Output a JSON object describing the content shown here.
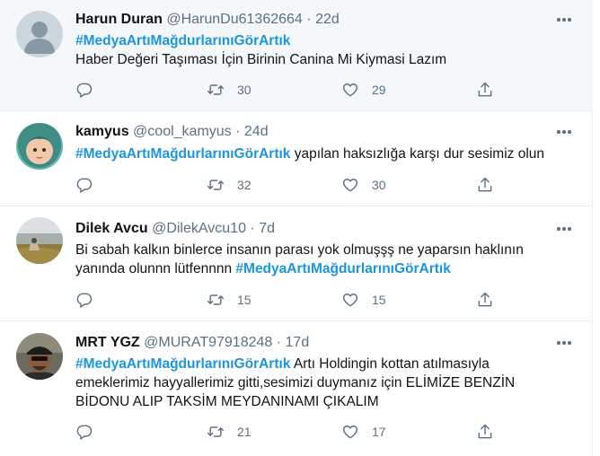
{
  "tweets": [
    {
      "name": "Harun Duran",
      "handle": "@HarunDu61362664",
      "dot": "·",
      "time": "22d",
      "hashtag": "#MedyaArtıMağdurlarınıGörArtık",
      "text_after": "",
      "line2": "Haber Değeri Taşıması İçin Birinin Canina Mi Kiymasi Lazım",
      "retweets": "30",
      "likes": "29"
    },
    {
      "name": "kamyus",
      "handle": "@cool_kamyus",
      "dot": "·",
      "time": "24d",
      "hashtag": "#MedyaArtıMağdurlarınıGörArtık",
      "text_after": " yapılan haksızlığa karşı dur sesimiz olun",
      "retweets": "32",
      "likes": "30"
    },
    {
      "name": "Dilek Avcu",
      "handle": "@DilekAvcu10",
      "dot": "·",
      "time": "7d",
      "line1": "Bi sabah kalkın binlerce insanın parası yok olmuşşş ne yaparsın haklının",
      "line2_before": "yanında olunnn lütfennnn ",
      "hashtag": "#MedyaArtıMağdurlarınıGörArtık",
      "retweets": "15",
      "likes": "15"
    },
    {
      "name": "MRT YGZ",
      "handle": "@MURAT97918248",
      "dot": "·",
      "time": "17d",
      "hashtag": "#MedyaArtıMağdurlarınıGörArtık",
      "text_after": " Artı Holdingin kottan atılmasıyla",
      "line2": "emeklerimiz hayyallerimiz gitti,sesimizi duymanız için ELİMİZE BENZİN",
      "line3": "BİDONU ALIP TAKSİM MEYDANINAMI ÇIKALIM",
      "retweets": "21",
      "likes": "17"
    }
  ]
}
